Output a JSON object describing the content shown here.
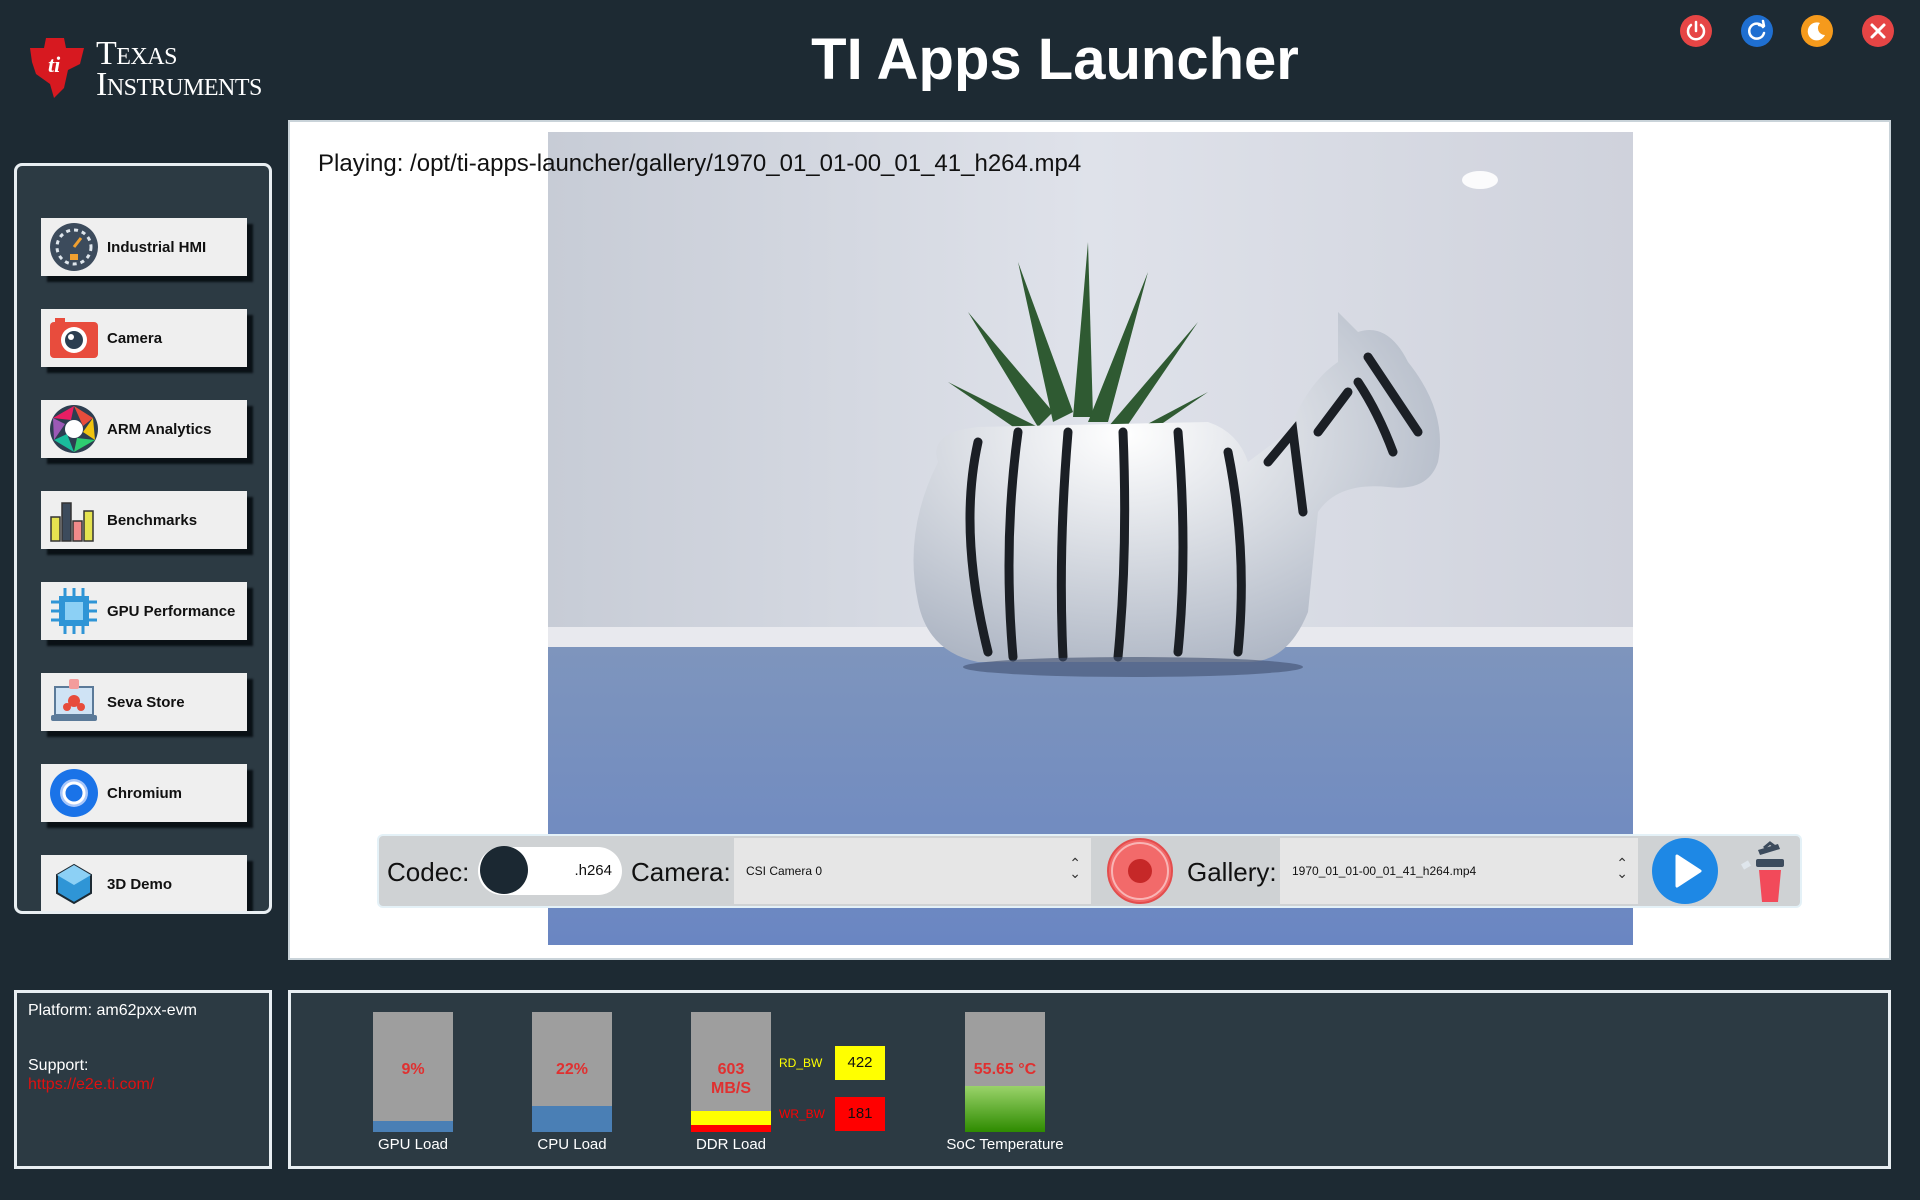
{
  "header": {
    "logo": {
      "line1": "Texas",
      "line2": "Instruments"
    },
    "title": "TI Apps Launcher",
    "buttons": [
      {
        "name": "power-icon",
        "color": "#e64545"
      },
      {
        "name": "refresh-icon",
        "color": "#1f6fd1"
      },
      {
        "name": "moon-icon",
        "color": "#f59a1c"
      },
      {
        "name": "close-icon",
        "color": "#e64545"
      }
    ]
  },
  "sidebar": {
    "items": [
      {
        "label": "Industrial HMI",
        "icon": "gauge-icon"
      },
      {
        "label": "Camera",
        "icon": "camera-icon"
      },
      {
        "label": "ARM Analytics",
        "icon": "aperture-icon"
      },
      {
        "label": "Benchmarks",
        "icon": "bar-chart-icon"
      },
      {
        "label": "GPU Performance",
        "icon": "chip-icon"
      },
      {
        "label": "Seva Store",
        "icon": "store-icon"
      },
      {
        "label": "Chromium",
        "icon": "chromium-icon"
      },
      {
        "label": "3D Demo",
        "icon": "cube-icon"
      }
    ]
  },
  "main": {
    "playing_text": "Playing: /opt/ti-apps-launcher/gallery/1970_01_01-00_01_41_h264.mp4"
  },
  "controls": {
    "codec_label": "Codec:",
    "codec_value": ".h264",
    "camera_label": "Camera:",
    "camera_value": "CSI Camera 0",
    "gallery_label": "Gallery:",
    "gallery_value": "1970_01_01-00_01_41_h264.mp4"
  },
  "footer": {
    "platform": "Platform: am62pxx-evm",
    "support_label": "Support:",
    "support_link": "https://e2e.ti.com/"
  },
  "stats": {
    "gpu": {
      "value": "9%",
      "label": "GPU Load",
      "fraction": 0.09
    },
    "cpu": {
      "value": "22%",
      "label": "CPU Load",
      "fraction": 0.22
    },
    "ddr": {
      "value_line1": "603",
      "value_line2": "MB/S",
      "label": "DDR Load",
      "rd_label": "RD_BW",
      "rd_value": "422",
      "wr_label": "WR_BW",
      "wr_value": "181"
    },
    "soc": {
      "value": "55.65 °C",
      "label": "SoC Temperature",
      "fraction": 0.38
    },
    "colors": {
      "bar_bg": "#9e9e9e",
      "load_fill": "#4a7fb5",
      "value_text": "#e03030",
      "rd": "#ffff00",
      "wr": "#ff0000",
      "temp": "#44b000"
    }
  }
}
